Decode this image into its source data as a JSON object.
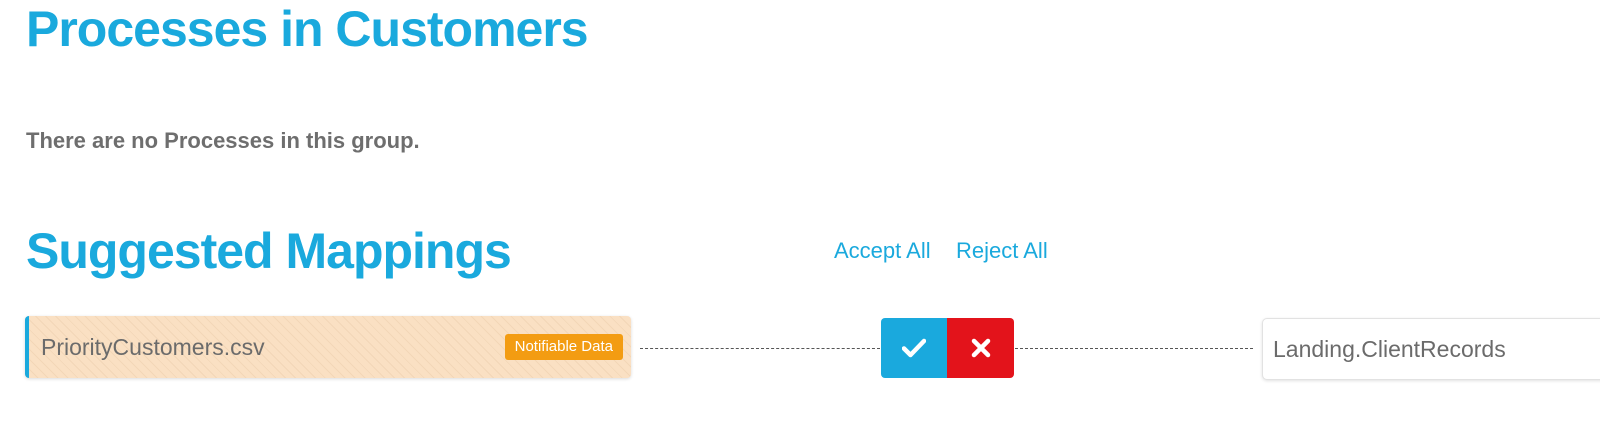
{
  "processes_section": {
    "title": "Processes in Customers",
    "empty_message": "There are no Processes in this group."
  },
  "suggested_section": {
    "title": "Suggested Mappings",
    "accept_all_label": "Accept All",
    "reject_all_label": "Reject All"
  },
  "mapping": {
    "source_name": "PriorityCustomers.csv",
    "badge_label": "Notifiable Data",
    "target_name": "Landing.ClientRecords",
    "accept_icon": "check-icon",
    "reject_icon": "close-icon"
  },
  "colors": {
    "accent": "#1aa9dd",
    "reject": "#e3131b",
    "badge": "#f39c12",
    "source_card_bg": "#fae0c3"
  }
}
